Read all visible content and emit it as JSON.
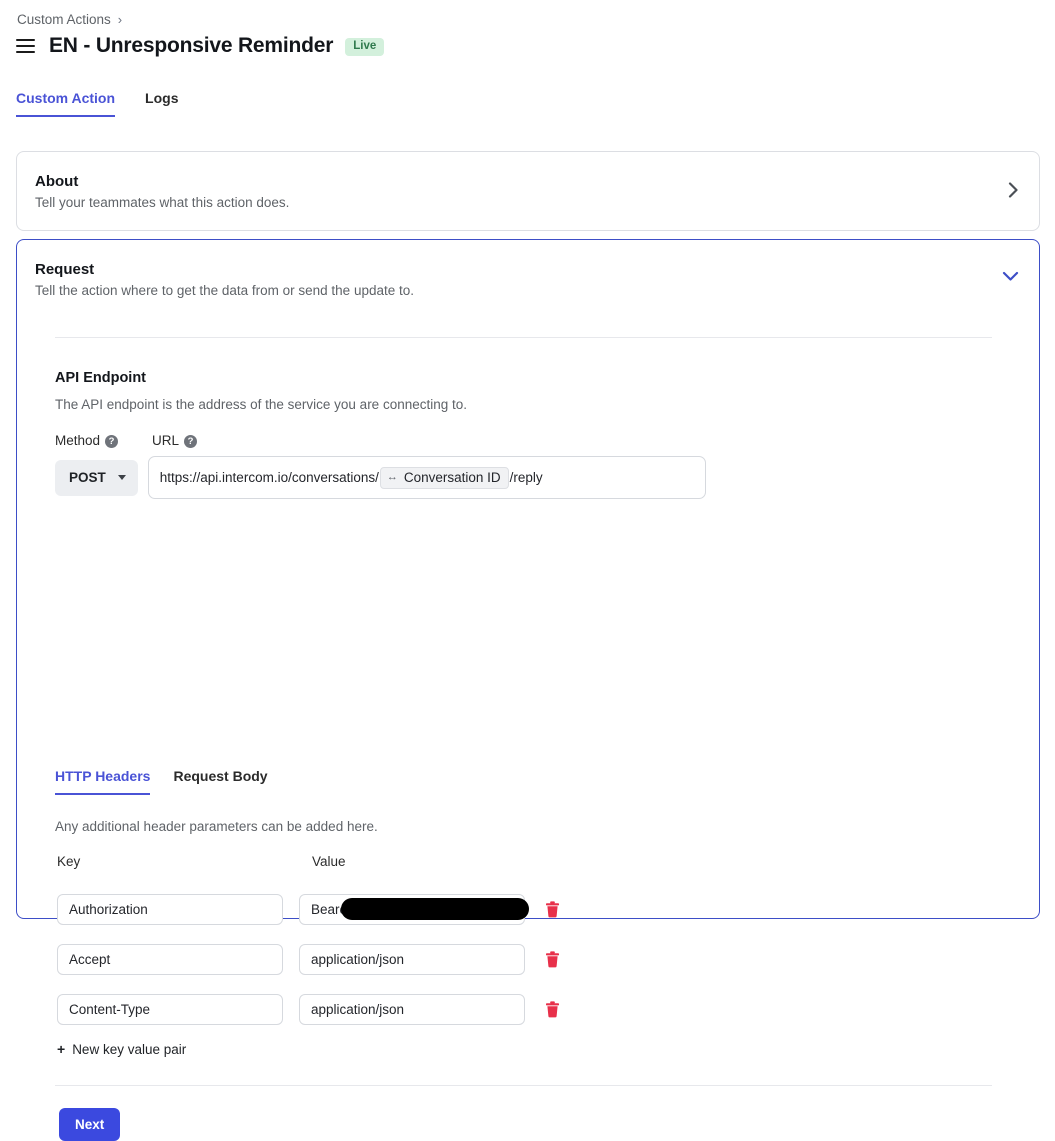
{
  "breadcrumb": {
    "label": "Custom Actions",
    "separator": "›"
  },
  "header": {
    "menu_icon": "hamburger-icon",
    "title": "EN - Unresponsive Reminder",
    "status_badge": "Live",
    "status_badge_bg": "#d3f0dc",
    "status_badge_color": "#2f7a4d"
  },
  "tabs": [
    {
      "label": "Custom Action",
      "active": true
    },
    {
      "label": "Logs",
      "active": false
    }
  ],
  "cards": {
    "about": {
      "title": "About",
      "subtitle": "Tell your teammates what this action does.",
      "chevron": "›",
      "chevron_name": "chevron-right-icon"
    },
    "request": {
      "title": "Request",
      "subtitle": "Tell the action where to get the data from or send the update to.",
      "chevron": "⌄",
      "chevron_name": "chevron-down-icon",
      "accent_color": "#3d4ec7"
    }
  },
  "endpoint": {
    "section_title": "API Endpoint",
    "section_desc": "The API endpoint is the address of the service you are connecting to.",
    "method_label": "Method",
    "url_label": "URL",
    "help_glyph": "?",
    "method_value": "POST",
    "url_prefix": "https://api.intercom.io/conversations/",
    "url_token_icon": "↔",
    "url_token_label": "Conversation ID",
    "url_suffix": "/reply"
  },
  "inner_tabs": [
    {
      "label": "HTTP Headers",
      "active": true
    },
    {
      "label": "Request Body",
      "active": false
    }
  ],
  "headers": {
    "description": "Any additional header parameters can be added here.",
    "columns": {
      "key": "Key",
      "value": "Value"
    },
    "rows": [
      {
        "key": "Authorization",
        "value": "Beare",
        "redacted": true
      },
      {
        "key": "Accept",
        "value": "application/json",
        "redacted": false
      },
      {
        "key": "Content-Type",
        "value": "application/json",
        "redacted": false
      }
    ],
    "add_row_label": "New key value pair",
    "add_row_glyph": "+",
    "delete_icon": "trash-icon",
    "delete_icon_color": "#e8304a"
  },
  "footer": {
    "next_label": "Next",
    "next_color": "#3b49df"
  }
}
